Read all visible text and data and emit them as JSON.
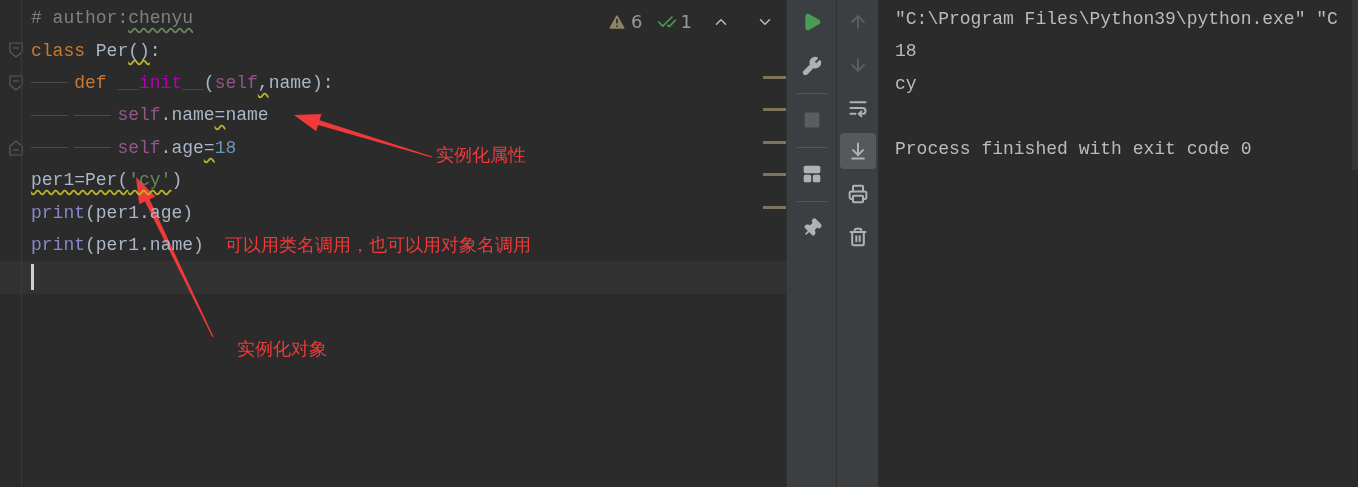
{
  "editor": {
    "inspections": [
      {
        "kind": "warning",
        "count": "6"
      },
      {
        "kind": "typo",
        "count": "1"
      }
    ],
    "lines": [
      {
        "tokens": [
          {
            "kind": "comment",
            "text": "# author:"
          },
          {
            "kind": "comment",
            "text": "chenyu",
            "typo": true
          }
        ]
      },
      {
        "fold_start": true,
        "tokens": [
          {
            "kind": "keyword",
            "text": "class "
          },
          {
            "kind": "plain",
            "text": "Per"
          },
          {
            "kind": "plain",
            "text": "()",
            "weak_warning": true
          },
          {
            "kind": "plain",
            "text": ":"
          }
        ],
        "children": [
          {
            "fold_start": true,
            "tokens": [
              {
                "kind": "keyword",
                "text": "def "
              },
              {
                "kind": "magic",
                "text": "__init__"
              },
              {
                "kind": "plain",
                "text": "("
              },
              {
                "kind": "self",
                "text": "self"
              },
              {
                "kind": "plain",
                "text": ",",
                "weak_warning": true
              },
              {
                "kind": "plain",
                "text": "name):"
              }
            ],
            "children": [
              {
                "tokens": [
                  {
                    "kind": "self",
                    "text": "self"
                  },
                  {
                    "kind": "plain",
                    "text": ".name"
                  },
                  {
                    "kind": "plain",
                    "text": "=",
                    "weak_warning": true
                  },
                  {
                    "kind": "plain",
                    "text": "name"
                  }
                ]
              },
              {
                "fold_end": true,
                "tokens": [
                  {
                    "kind": "self",
                    "text": "self"
                  },
                  {
                    "kind": "plain",
                    "text": ".age"
                  },
                  {
                    "kind": "plain",
                    "text": "=",
                    "weak_warning": true
                  },
                  {
                    "kind": "number",
                    "text": "18"
                  }
                ]
              }
            ]
          }
        ]
      },
      {
        "tokens": [
          {
            "kind": "plain",
            "text": "per1=Per(",
            "weak_warning": true
          },
          {
            "kind": "string",
            "text": "'cy'",
            "weak_warning": true
          },
          {
            "kind": "plain",
            "text": ")"
          }
        ]
      },
      {
        "tokens": [
          {
            "kind": "builtin",
            "text": "print"
          },
          {
            "kind": "plain",
            "text": "(per1.age)"
          }
        ]
      },
      {
        "tokens": [
          {
            "kind": "builtin",
            "text": "print"
          },
          {
            "kind": "plain",
            "text": "(per1.name)"
          }
        ]
      },
      {
        "current": true
      }
    ]
  },
  "annotations": [
    {
      "text": "实例化属性"
    },
    {
      "text": "可以用类名调用，也可以用对象名调用"
    },
    {
      "text": "实例化对象"
    }
  ],
  "run_tools": [
    {
      "items": [
        {
          "kind": "run",
          "disabled": false
        },
        {
          "kind": "settings",
          "disabled": false
        }
      ]
    },
    {
      "items": [
        {
          "kind": "stop",
          "disabled": true
        }
      ]
    },
    {
      "items": [
        {
          "kind": "layout",
          "disabled": false
        }
      ]
    },
    {
      "items": [
        {
          "kind": "pin",
          "disabled": false
        }
      ]
    }
  ],
  "console_tools": [
    {
      "kind": "up",
      "disabled": true,
      "selected": false
    },
    {
      "kind": "down",
      "disabled": true,
      "selected": false
    },
    {
      "kind": "wrap",
      "disabled": false,
      "selected": false
    },
    {
      "kind": "scroll_end",
      "disabled": false,
      "selected": true
    },
    {
      "kind": "print",
      "disabled": false,
      "selected": false
    },
    {
      "kind": "trash",
      "disabled": false,
      "selected": false
    }
  ],
  "console": {
    "output": [
      "\"C:\\Program Files\\Python39\\python.exe\" \"C",
      "18",
      "cy"
    ],
    "exit_message": "Process finished with exit code 0"
  }
}
